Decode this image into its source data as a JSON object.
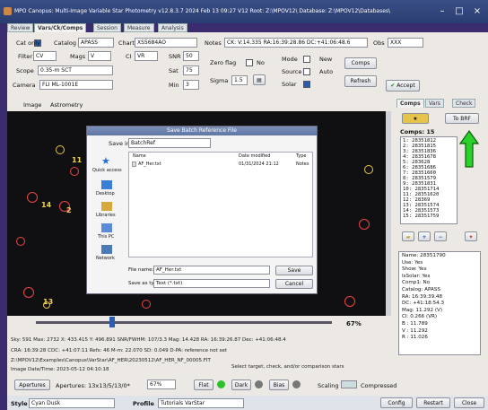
{
  "window": {
    "title": "MPO Canopus: Multi-Image Variable Star Photometry   v12.8.3.7  2024 Feb 13  09:27    V12 Root: Z:\\MPOV12\\   Database: Z:\\MPOV12\\Databases\\"
  },
  "tabs": [
    "Review",
    "Vars/Ck/Comps",
    "Session",
    "Measure",
    "Analysis"
  ],
  "row1": {
    "cat_only": "Cat only",
    "catalog_label": "Catalog",
    "catalog_value": "APASS",
    "chart_label": "Chart",
    "chart_value": "XS5684AO",
    "notes_label": "Notes",
    "notes_value": "CK: V:14.335 RA:16:39:28.86 DC:+41:06:48.6",
    "obs_label": "Obs",
    "obs_value": "XXX"
  },
  "row2": {
    "filter_label": "Filter",
    "filter_value": "CV",
    "mags_label": "Mags",
    "mags_value": "V",
    "ci_label": "CI",
    "ci_value": "VR",
    "snr_label": "SNR",
    "snr_value": "50",
    "zero_flag": "Zero flag",
    "no": "No",
    "mode": "Mode",
    "new": "New",
    "comps_btn": "Comps"
  },
  "row3": {
    "scope_label": "Scope",
    "scope_value": "0.35-m SCT",
    "sat_label": "Sat",
    "sat_value": "75",
    "sigma_label": "Sigma",
    "sigma_value": "1.5",
    "source": "Source",
    "auto": "Auto",
    "refresh": "Refresh"
  },
  "row4": {
    "camera_label": "Camera",
    "camera_value": "FLI ML-1001E",
    "min_label": "Min",
    "min_value": "3",
    "solar": "Solar",
    "accept": "Accept"
  },
  "subtabs": [
    "Image",
    "Astrometry"
  ],
  "dialog": {
    "title": "Save Batch Reference File",
    "save_in_label": "Save in:",
    "save_in_value": "BatchRef",
    "places": [
      "Quick access",
      "Desktop",
      "Libraries",
      "This PC",
      "Network"
    ],
    "col_name": "Name",
    "col_date": "Date modified",
    "col_type": "Type",
    "file_name": "AF_Her.txt",
    "file_date": "01/31/2024 21:12",
    "file_type": "Notes",
    "filename_label": "File name:",
    "filename_value": "AF_Her.txt",
    "savetype_label": "Save as type:",
    "savetype_value": "Text (*.txt)",
    "save_btn": "Save",
    "cancel_btn": "Cancel"
  },
  "star_labels": [
    "11",
    "14",
    "2",
    "13"
  ],
  "zoom_pct": "67%",
  "status": {
    "line1": "Sky: 591    Max: 2732    X: 433.415    Y: 496.891    SNR/FWHM: 107/3.3    Mag: 14.428   RA: 16:39:26.87    Dec: +41:06:48.4",
    "line2": "CRA: 16:39:28    CDC: +41:07:11    Refs: 46    M-m: 22.070    SD: 0.049    D-PA: reference not set",
    "line3": "Z:\\MPOV12\\Examples\\Canopus\\VarStar\\AF_HER\\20230512\\AF_HER_NF_00005.FIT",
    "line4": "Image Date/Time: 2023-05-12  04:10:18",
    "hint": "Select target, check, and/or comparison stars"
  },
  "bottom": {
    "apertures_btn": "Apertures",
    "apertures_text": "Apertures: 13x13/5/13/0*",
    "zoom_select": "67%",
    "flat": "Flat",
    "dark": "Dark",
    "bias": "Bias",
    "scaling": "Scaling",
    "compressed": "Compressed"
  },
  "footer": {
    "style_label": "Style",
    "style_value": "Cyan Dusk",
    "profile_label": "Profile",
    "profile_value": "Tutorials VarStar",
    "config": "Config",
    "restart": "Restart",
    "close": "Close"
  },
  "side": {
    "tabs": [
      "Comps",
      "Vars",
      "Check"
    ],
    "to_brf": "To BRF",
    "comps_title": "Comps: 15",
    "comps": [
      "1: 28351812",
      "2: 28351815",
      "3: 28351836",
      "4: 28351678",
      "5: 283628",
      "6: 28351686",
      "7: 28351660",
      "8: 28351579",
      "9: 28351831",
      "10: 28351714",
      "11: 28351620",
      "12: 28369",
      "13: 28351574",
      "14: 28351573",
      "15: 28351759"
    ],
    "info": [
      "Name: 28351790",
      "Use: Yes",
      "Show: Yes",
      "IsSolar: Yes",
      "Comp1: No",
      "Catalog: APASS",
      "RA: 16:39:39.48",
      "DC: +41:18:54.3",
      "Mag: 11.292 (V)",
      "CI: 0.266 (VR)",
      "B  : 11.789",
      "V  : 11.292",
      "R  : 11.026"
    ]
  },
  "colors": {
    "arrow": "#2bd12b",
    "title_bg": "#2a3d72",
    "accent": "#2a5db0"
  }
}
